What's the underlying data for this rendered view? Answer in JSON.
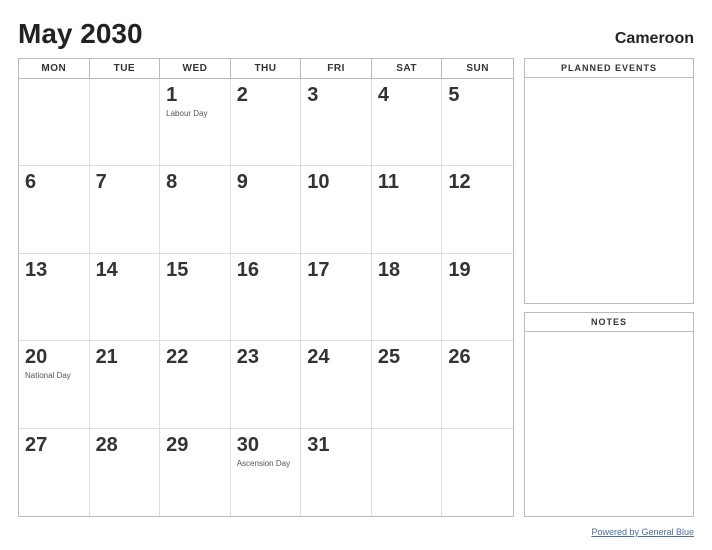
{
  "header": {
    "title": "May 2030",
    "country": "Cameroon"
  },
  "day_headers": [
    "MON",
    "TUE",
    "WED",
    "THU",
    "FRI",
    "SAT",
    "SUN"
  ],
  "weeks": [
    [
      {
        "empty": true
      },
      {
        "empty": true
      },
      {
        "day": "1",
        "event": "Labour Day"
      },
      {
        "day": "2"
      },
      {
        "day": "3"
      },
      {
        "day": "4"
      },
      {
        "day": "5"
      }
    ],
    [
      {
        "day": "6"
      },
      {
        "day": "7"
      },
      {
        "day": "8"
      },
      {
        "day": "9"
      },
      {
        "day": "10"
      },
      {
        "day": "11"
      },
      {
        "day": "12"
      }
    ],
    [
      {
        "day": "13"
      },
      {
        "day": "14"
      },
      {
        "day": "15"
      },
      {
        "day": "16"
      },
      {
        "day": "17"
      },
      {
        "day": "18"
      },
      {
        "day": "19"
      }
    ],
    [
      {
        "day": "20",
        "event": "National Day"
      },
      {
        "day": "21"
      },
      {
        "day": "22"
      },
      {
        "day": "23"
      },
      {
        "day": "24"
      },
      {
        "day": "25"
      },
      {
        "day": "26"
      }
    ],
    [
      {
        "day": "27"
      },
      {
        "day": "28"
      },
      {
        "day": "29"
      },
      {
        "day": "30",
        "event": "Ascension Day"
      },
      {
        "day": "31"
      },
      {
        "empty": true,
        "last": true
      },
      {
        "empty": true,
        "last": true
      }
    ]
  ],
  "side_panel": {
    "planned_events_label": "PLANNED EVENTS",
    "notes_label": "NOTES"
  },
  "footer": {
    "link_text": "Powered by General Blue"
  }
}
